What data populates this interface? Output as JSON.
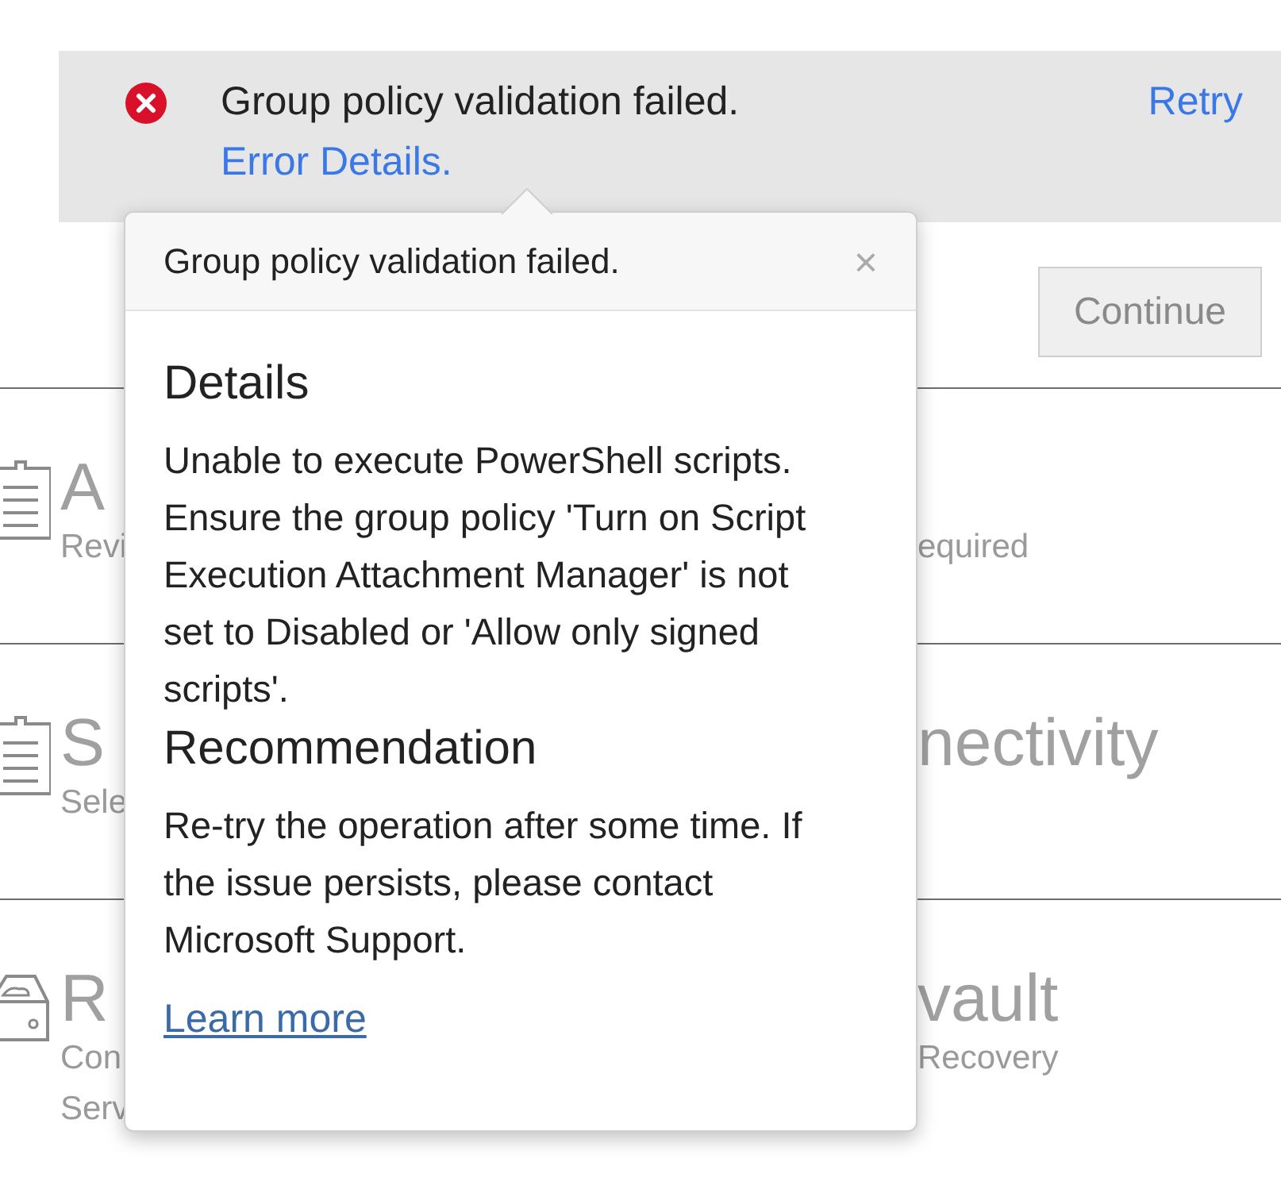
{
  "banner": {
    "kind": "error",
    "message": "Group policy validation failed.",
    "link": "Error Details.",
    "action": "Retry"
  },
  "continue_button": {
    "label": "Continue",
    "disabled": true
  },
  "steps": [
    {
      "kind": "document",
      "left_title": "A",
      "left_subtitle": [
        "Revi"
      ],
      "right_subtitle": [
        "equired"
      ]
    },
    {
      "kind": "document",
      "left_title": "S",
      "left_subtitle": [
        "Sele"
      ],
      "right_title": "nectivity"
    },
    {
      "kind": "drive",
      "left_title": "R",
      "left_subtitle": [
        "Con",
        "Serv"
      ],
      "right_title": "vault",
      "right_subtitle": [
        "Recovery"
      ]
    }
  ],
  "popup": {
    "title": "Group policy validation failed.",
    "close": "×",
    "sections": [
      {
        "heading": "Details",
        "text": "Unable to execute PowerShell scripts. Ensure the group policy 'Turn on Script Execution Attachment Manager' is not set to Disabled or 'Allow only signed scripts'."
      },
      {
        "heading": "Recommendation",
        "text": "Re-try the operation after some time. If the issue persists, please contact Microsoft Support."
      }
    ],
    "link": "Learn more"
  }
}
